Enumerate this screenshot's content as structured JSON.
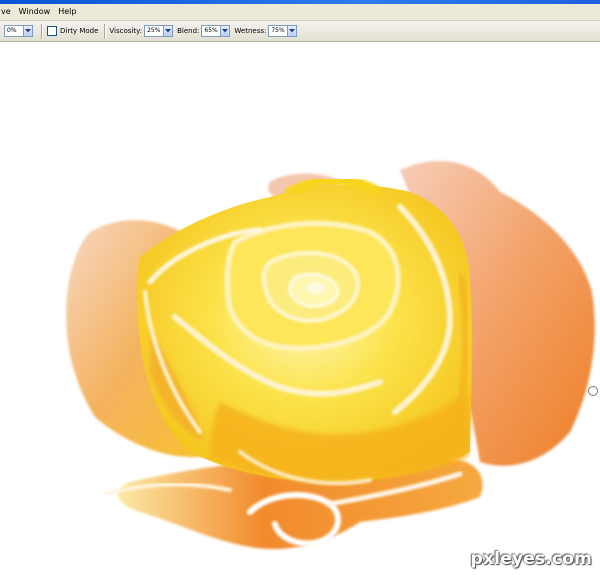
{
  "menubar": {
    "items": [
      "ve",
      "Window",
      "Help"
    ]
  },
  "options": {
    "first_value": "0%",
    "dirty_mode_label": "Dirty Mode",
    "dirty_mode_checked": false,
    "viscosity_label": "Viscosity:",
    "viscosity_value": "25%",
    "blend_label": "Blend:",
    "blend_value": "65%",
    "wetness_label": "Wetness:",
    "wetness_value": "75%"
  },
  "canvas": {
    "subject": "painted yellow rose",
    "watermark": "pxleyes.com"
  },
  "colors": {
    "title_bar": "#2c7cf0",
    "menubar_bg": "#ece9d8",
    "rose_yellow": "#f7d51c",
    "rose_orange": "#f28a2c",
    "rose_peach": "#f3b08a"
  }
}
